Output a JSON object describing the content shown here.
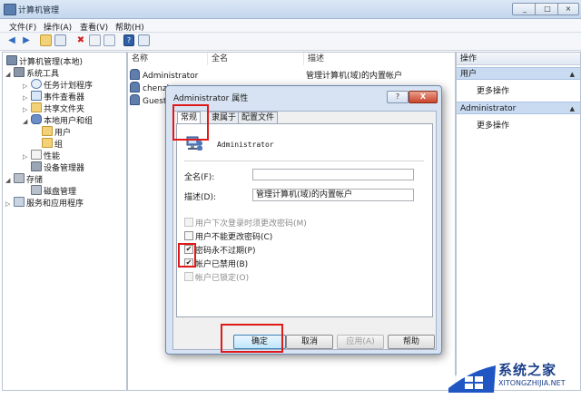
{
  "window": {
    "title": "计算机管理"
  },
  "caption_buttons": [
    "_",
    "□",
    "×"
  ],
  "menu": [
    "文件(F)",
    "操作(A)",
    "查看(V)",
    "帮助(H)"
  ],
  "tree": [
    {
      "label": "计算机管理(本地)",
      "icon": "computer-icon"
    },
    {
      "label": "系统工具",
      "icon": "tools-icon"
    },
    {
      "label": "任务计划程序",
      "icon": "clock-icon"
    },
    {
      "label": "事件查看器",
      "icon": "event-viewer-icon"
    },
    {
      "label": "共享文件夹",
      "icon": "folder-icon"
    },
    {
      "label": "本地用户和组",
      "icon": "users-icon"
    },
    {
      "label": "用户",
      "icon": "folder-icon"
    },
    {
      "label": "组",
      "icon": "folder-icon"
    },
    {
      "label": "性能",
      "icon": "performance-icon"
    },
    {
      "label": "设备管理器",
      "icon": "device-manager-icon"
    },
    {
      "label": "存储",
      "icon": "storage-icon"
    },
    {
      "label": "磁盘管理",
      "icon": "disk-icon"
    },
    {
      "label": "服务和应用程序",
      "icon": "services-icon"
    }
  ],
  "list": {
    "columns": [
      "名称",
      "全名",
      "描述"
    ],
    "rows": [
      {
        "name": "Administrator",
        "fullname": "",
        "desc": "管理计算机(域)的内置帐户"
      },
      {
        "name": "chenzh",
        "fullname": "",
        "desc": ""
      },
      {
        "name": "Guest",
        "fullname": "",
        "desc": ""
      }
    ]
  },
  "actions": {
    "header": "操作",
    "sections": [
      {
        "title": "用户",
        "item": "更多操作"
      },
      {
        "title": "Administrator",
        "item": "更多操作"
      }
    ]
  },
  "dialog": {
    "title": "Administrator 属性",
    "help_btn": "?",
    "close_btn": "X",
    "tabs": [
      "常规",
      "隶属于",
      "配置文件"
    ],
    "username": "Administrator",
    "fullname_label": "全名(F):",
    "fullname_value": "",
    "desc_label": "描述(D):",
    "desc_value": "管理计算机(域)的内置帐户",
    "checkboxes": [
      {
        "label": "用户下次登录时须更改密码(M)",
        "checked": false,
        "enabled": false
      },
      {
        "label": "用户不能更改密码(C)",
        "checked": false,
        "enabled": true
      },
      {
        "label": "密码永不过期(P)",
        "checked": true,
        "enabled": true
      },
      {
        "label": "帐户已禁用(B)",
        "checked": true,
        "enabled": true
      },
      {
        "label": "帐户已锁定(O)",
        "checked": false,
        "enabled": false
      }
    ],
    "buttons": {
      "ok": "确定",
      "cancel": "取消",
      "apply": "应用(A)",
      "help": "帮助"
    }
  },
  "watermark": {
    "name": "系统之家",
    "url": "XITONGZHIJIA.NET"
  },
  "colors": {
    "highlight_red": "#e01919",
    "title_blue": "#c4d7ee",
    "watermark_blue": "#1a3f8a"
  }
}
